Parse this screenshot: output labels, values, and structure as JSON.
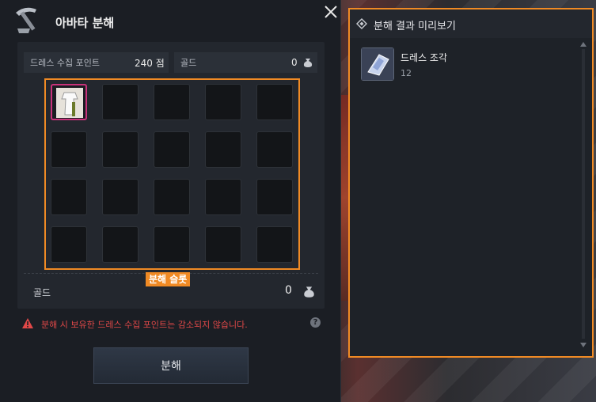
{
  "dialog": {
    "title": "아바타 분해",
    "stats": {
      "points_label": "드레스 수집 포인트",
      "points_value": "240 점",
      "gold_label": "골드",
      "gold_value": "0"
    },
    "slot_label": "분해 슬롯",
    "gold_row": {
      "label": "골드",
      "value": "0"
    },
    "warning": "분해 시 보유한 드레스 수집 포인트는 감소되지 않습니다.",
    "help": "?",
    "button_label": "분해"
  },
  "preview": {
    "title": "분해 결과 미리보기",
    "items": [
      {
        "name": "드레스 조각",
        "count": "12"
      }
    ]
  },
  "colors": {
    "highlight": "#f08a24",
    "warning": "#e04848",
    "slot_selected": "#c8327a"
  }
}
